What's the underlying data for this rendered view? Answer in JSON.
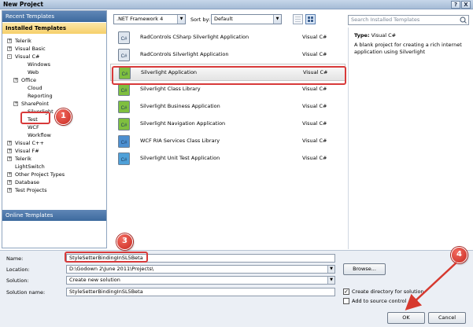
{
  "window": {
    "title": "New Project",
    "help_label": "?",
    "close_label": "X"
  },
  "left": {
    "recent_header": "Recent Templates",
    "installed_header": "Installed Templates",
    "online_header": "Online Templates",
    "tree": [
      {
        "label": "Telerik",
        "expander": "+"
      },
      {
        "label": "Visual Basic",
        "expander": "+"
      },
      {
        "label": "Visual C#",
        "expander": "-"
      },
      {
        "label": "Windows",
        "expander": ""
      },
      {
        "label": "Web",
        "expander": ""
      },
      {
        "label": "Office",
        "expander": "+"
      },
      {
        "label": "Cloud",
        "expander": ""
      },
      {
        "label": "Reporting",
        "expander": ""
      },
      {
        "label": "SharePoint",
        "expander": "+"
      },
      {
        "label": "Silverlight",
        "expander": ""
      },
      {
        "label": "Test",
        "expander": ""
      },
      {
        "label": "WCF",
        "expander": ""
      },
      {
        "label": "Workflow",
        "expander": ""
      },
      {
        "label": "Visual C++",
        "expander": "+"
      },
      {
        "label": "Visual F#",
        "expander": "+"
      },
      {
        "label": "Telerik",
        "expander": "+"
      },
      {
        "label": "LightSwitch",
        "expander": ""
      },
      {
        "label": "Other Project Types",
        "expander": "+"
      },
      {
        "label": "Database",
        "expander": "+"
      },
      {
        "label": "Test Projects",
        "expander": "+"
      }
    ]
  },
  "toolbar": {
    "framework": ".NET Framework 4",
    "sort_label": "Sort by:",
    "sort_value": "Default",
    "search_placeholder": "Search Installed Templates"
  },
  "templates": [
    {
      "name": "RadControls CSharp Silverlight Application",
      "lang": "Visual C#",
      "icon": "radcontrols-cs-icon"
    },
    {
      "name": "RadControls Silverlight Application",
      "lang": "Visual C#",
      "icon": "radcontrols-icon"
    },
    {
      "name": "Silverlight Application",
      "lang": "Visual C#",
      "icon": "silverlight-app-icon"
    },
    {
      "name": "Silverlight Class Library",
      "lang": "Visual C#",
      "icon": "silverlight-classlib-icon"
    },
    {
      "name": "Silverlight Business Application",
      "lang": "Visual C#",
      "icon": "silverlight-business-icon"
    },
    {
      "name": "Silverlight Navigation Application",
      "lang": "Visual C#",
      "icon": "silverlight-nav-icon"
    },
    {
      "name": "WCF RIA Services Class Library",
      "lang": "Visual C#",
      "icon": "wcf-ria-icon"
    },
    {
      "name": "Silverlight Unit Test Application",
      "lang": "Visual C#",
      "icon": "silverlight-unittest-icon"
    }
  ],
  "details": {
    "type_label": "Type:",
    "type_value": "Visual C#",
    "description": "A blank project for creating a rich internet application using Silverlight"
  },
  "form": {
    "name_label": "Name:",
    "name_value": "StyleSetterBindingInSL5Beta",
    "location_label": "Location:",
    "location_value": "D:\\Godown 2\\June 2011\\Projects\\",
    "solution_label": "Solution:",
    "solution_value": "Create new solution",
    "solution_name_label": "Solution name:",
    "solution_name_value": "StyleSetterBindingInSL5Beta",
    "browse_label": "Browse...",
    "create_dir_label": "Create directory for solution",
    "source_control_label": "Add to source control",
    "ok_label": "OK",
    "cancel_label": "Cancel"
  },
  "callouts": [
    "1",
    "2",
    "3",
    "4"
  ],
  "colors": {
    "callout": "#d6392f",
    "highlight": "#d83a3a",
    "installed_header": "#f6cf6a",
    "header_blue": "#3d6a9e"
  }
}
